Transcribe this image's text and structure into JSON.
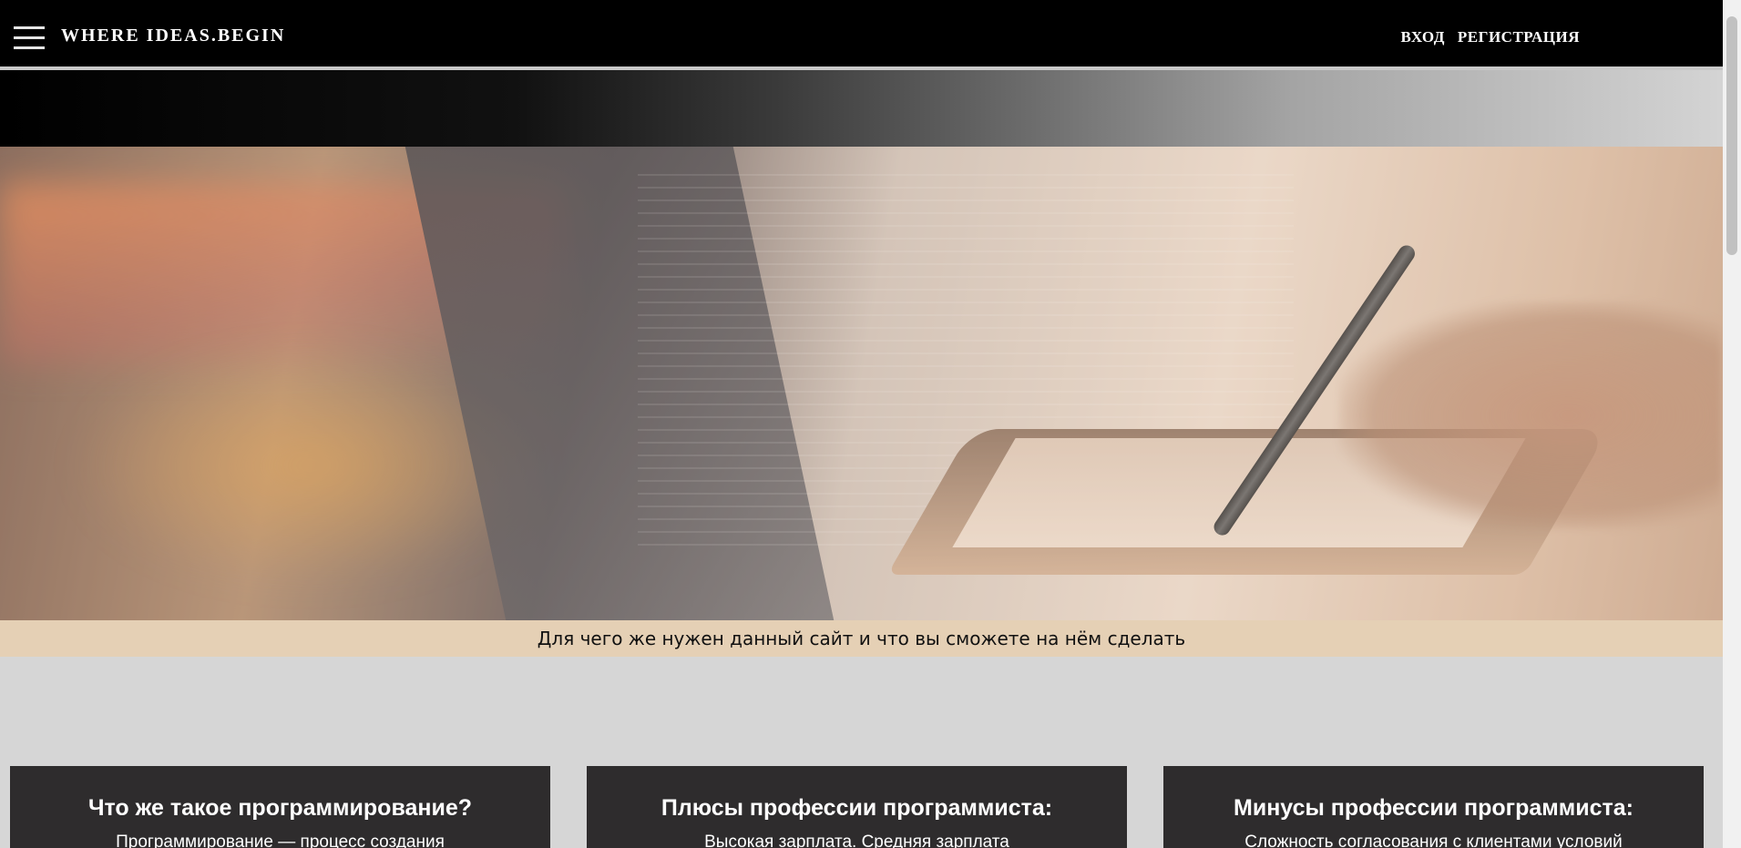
{
  "navbar": {
    "brand": "WHERE IDEAS.BEGIN",
    "login_label": "ВХОД",
    "register_label": "РЕГИСТРАЦИЯ"
  },
  "hero": {
    "caption": "Для чего же нужен данный сайт и что вы сможете на нём сделать"
  },
  "cards": [
    {
      "title": "Что же такое программирование?",
      "text": "Программирование — процесс создания"
    },
    {
      "title": "Плюсы профессии программиста:",
      "text": "Высокая зарплата. Средняя зарплата"
    },
    {
      "title": "Минусы профессии программиста:",
      "text": "Сложность согласования с клиентами условий"
    }
  ],
  "colors": {
    "navbar_bg": "#000000",
    "caption_bg": "#e5d0b5",
    "card_bg": "#2e2c2d",
    "page_bg": "#d6d6d6"
  }
}
